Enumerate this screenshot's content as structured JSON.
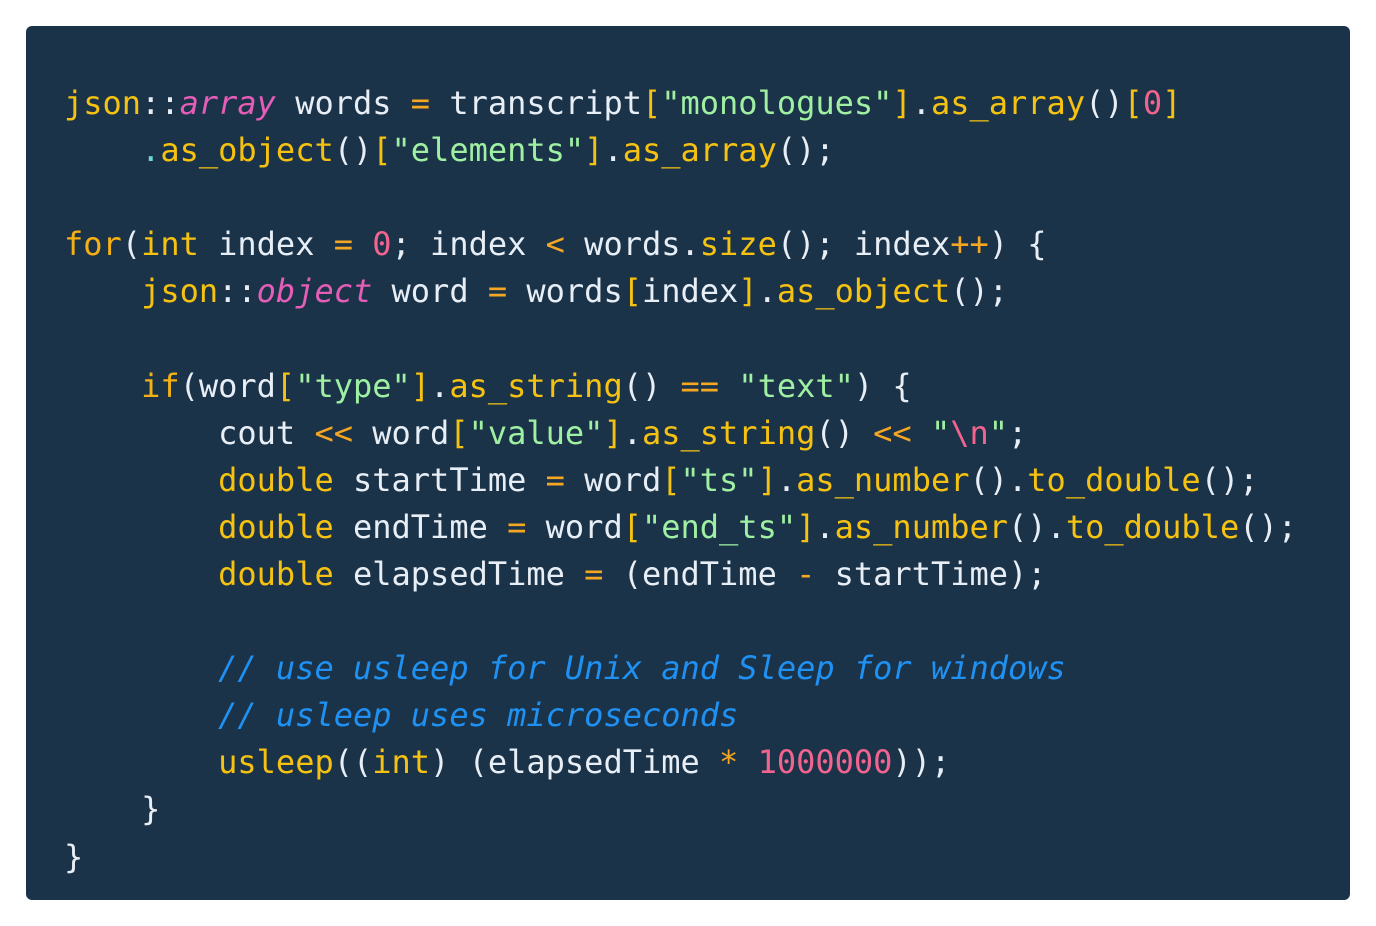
{
  "colors": {
    "page_background": "#ffffff",
    "panel_background": "#1b3349",
    "plain": "#e7eef6",
    "keyword": "#f5b114",
    "type": "#f5c211",
    "type_italic": "#e45db7",
    "function": "#f5c211",
    "string": "#9ff0a2",
    "number": "#f2648f",
    "operator": "#f5a623",
    "comment": "#1f91f3"
  },
  "code": {
    "language": "cpp",
    "lines": [
      [
        {
          "t": "json",
          "k": "type"
        },
        {
          "t": "::",
          "k": "punct"
        },
        {
          "t": "array",
          "k": "typeit"
        },
        {
          "t": " words ",
          "k": "ident"
        },
        {
          "t": "=",
          "k": "operator"
        },
        {
          "t": " transcript",
          "k": "ident"
        },
        {
          "t": "[",
          "k": "bracket"
        },
        {
          "t": "\"monologues\"",
          "k": "string"
        },
        {
          "t": "]",
          "k": "bracket"
        },
        {
          "t": ".",
          "k": "punct"
        },
        {
          "t": "as_array",
          "k": "func"
        },
        {
          "t": "()",
          "k": "punct"
        },
        {
          "t": "[",
          "k": "bracket"
        },
        {
          "t": "0",
          "k": "number"
        },
        {
          "t": "]",
          "k": "bracket"
        }
      ],
      [
        {
          "t": "    ",
          "k": "plain"
        },
        {
          "t": ".",
          "k": "method-dot"
        },
        {
          "t": "as_object",
          "k": "func"
        },
        {
          "t": "()",
          "k": "punct"
        },
        {
          "t": "[",
          "k": "bracket"
        },
        {
          "t": "\"elements\"",
          "k": "string"
        },
        {
          "t": "]",
          "k": "bracket"
        },
        {
          "t": ".",
          "k": "punct"
        },
        {
          "t": "as_array",
          "k": "func"
        },
        {
          "t": "();",
          "k": "punct"
        }
      ],
      [],
      [
        {
          "t": "for",
          "k": "keyword"
        },
        {
          "t": "(",
          "k": "punct"
        },
        {
          "t": "int",
          "k": "type"
        },
        {
          "t": " index ",
          "k": "ident"
        },
        {
          "t": "=",
          "k": "operator"
        },
        {
          "t": " ",
          "k": "plain"
        },
        {
          "t": "0",
          "k": "number"
        },
        {
          "t": "; index ",
          "k": "ident"
        },
        {
          "t": "<",
          "k": "operator"
        },
        {
          "t": " words",
          "k": "ident"
        },
        {
          "t": ".",
          "k": "punct"
        },
        {
          "t": "size",
          "k": "func"
        },
        {
          "t": "(); index",
          "k": "punct"
        },
        {
          "t": "++",
          "k": "operator"
        },
        {
          "t": ") {",
          "k": "punct"
        }
      ],
      [
        {
          "t": "    ",
          "k": "plain"
        },
        {
          "t": "json",
          "k": "type"
        },
        {
          "t": "::",
          "k": "punct"
        },
        {
          "t": "object",
          "k": "typeit"
        },
        {
          "t": " word ",
          "k": "ident"
        },
        {
          "t": "=",
          "k": "operator"
        },
        {
          "t": " words",
          "k": "ident"
        },
        {
          "t": "[",
          "k": "bracket"
        },
        {
          "t": "index",
          "k": "ident"
        },
        {
          "t": "]",
          "k": "bracket"
        },
        {
          "t": ".",
          "k": "punct"
        },
        {
          "t": "as_object",
          "k": "func"
        },
        {
          "t": "();",
          "k": "punct"
        }
      ],
      [],
      [
        {
          "t": "    ",
          "k": "plain"
        },
        {
          "t": "if",
          "k": "keyword"
        },
        {
          "t": "(",
          "k": "punct"
        },
        {
          "t": "word",
          "k": "ident"
        },
        {
          "t": "[",
          "k": "bracket"
        },
        {
          "t": "\"type\"",
          "k": "string"
        },
        {
          "t": "]",
          "k": "bracket"
        },
        {
          "t": ".",
          "k": "punct"
        },
        {
          "t": "as_string",
          "k": "func"
        },
        {
          "t": "() ",
          "k": "punct"
        },
        {
          "t": "==",
          "k": "operator"
        },
        {
          "t": " ",
          "k": "plain"
        },
        {
          "t": "\"text\"",
          "k": "string"
        },
        {
          "t": ") {",
          "k": "punct"
        }
      ],
      [
        {
          "t": "        cout ",
          "k": "ident"
        },
        {
          "t": "<<",
          "k": "operator"
        },
        {
          "t": " word",
          "k": "ident"
        },
        {
          "t": "[",
          "k": "bracket"
        },
        {
          "t": "\"value\"",
          "k": "string"
        },
        {
          "t": "]",
          "k": "bracket"
        },
        {
          "t": ".",
          "k": "punct"
        },
        {
          "t": "as_string",
          "k": "func"
        },
        {
          "t": "() ",
          "k": "punct"
        },
        {
          "t": "<<",
          "k": "operator"
        },
        {
          "t": " ",
          "k": "plain"
        },
        {
          "t": "\"",
          "k": "string"
        },
        {
          "t": "\\n",
          "k": "escape"
        },
        {
          "t": "\"",
          "k": "string"
        },
        {
          "t": ";",
          "k": "punct"
        }
      ],
      [
        {
          "t": "        ",
          "k": "plain"
        },
        {
          "t": "double",
          "k": "type"
        },
        {
          "t": " startTime ",
          "k": "ident"
        },
        {
          "t": "=",
          "k": "operator"
        },
        {
          "t": " word",
          "k": "ident"
        },
        {
          "t": "[",
          "k": "bracket"
        },
        {
          "t": "\"ts\"",
          "k": "string"
        },
        {
          "t": "]",
          "k": "bracket"
        },
        {
          "t": ".",
          "k": "punct"
        },
        {
          "t": "as_number",
          "k": "func"
        },
        {
          "t": "().",
          "k": "punct"
        },
        {
          "t": "to_double",
          "k": "func"
        },
        {
          "t": "();",
          "k": "punct"
        }
      ],
      [
        {
          "t": "        ",
          "k": "plain"
        },
        {
          "t": "double",
          "k": "type"
        },
        {
          "t": " endTime ",
          "k": "ident"
        },
        {
          "t": "=",
          "k": "operator"
        },
        {
          "t": " word",
          "k": "ident"
        },
        {
          "t": "[",
          "k": "bracket"
        },
        {
          "t": "\"end_ts\"",
          "k": "string"
        },
        {
          "t": "]",
          "k": "bracket"
        },
        {
          "t": ".",
          "k": "punct"
        },
        {
          "t": "as_number",
          "k": "func"
        },
        {
          "t": "().",
          "k": "punct"
        },
        {
          "t": "to_double",
          "k": "func"
        },
        {
          "t": "();",
          "k": "punct"
        }
      ],
      [
        {
          "t": "        ",
          "k": "plain"
        },
        {
          "t": "double",
          "k": "type"
        },
        {
          "t": " elapsedTime ",
          "k": "ident"
        },
        {
          "t": "=",
          "k": "operator"
        },
        {
          "t": " (endTime ",
          "k": "ident"
        },
        {
          "t": "-",
          "k": "operator"
        },
        {
          "t": " startTime);",
          "k": "ident"
        }
      ],
      [],
      [
        {
          "t": "        ",
          "k": "plain"
        },
        {
          "t": "// use usleep for Unix and Sleep for windows",
          "k": "comment"
        }
      ],
      [
        {
          "t": "        ",
          "k": "plain"
        },
        {
          "t": "// usleep uses microseconds",
          "k": "comment"
        }
      ],
      [
        {
          "t": "        ",
          "k": "plain"
        },
        {
          "t": "usleep",
          "k": "func"
        },
        {
          "t": "((",
          "k": "punct"
        },
        {
          "t": "int",
          "k": "type"
        },
        {
          "t": ") (elapsedTime ",
          "k": "ident"
        },
        {
          "t": "*",
          "k": "operator"
        },
        {
          "t": " ",
          "k": "plain"
        },
        {
          "t": "1000000",
          "k": "number"
        },
        {
          "t": "));",
          "k": "punct"
        }
      ],
      [
        {
          "t": "    }",
          "k": "punct"
        }
      ],
      [
        {
          "t": "}",
          "k": "punct"
        }
      ]
    ]
  }
}
